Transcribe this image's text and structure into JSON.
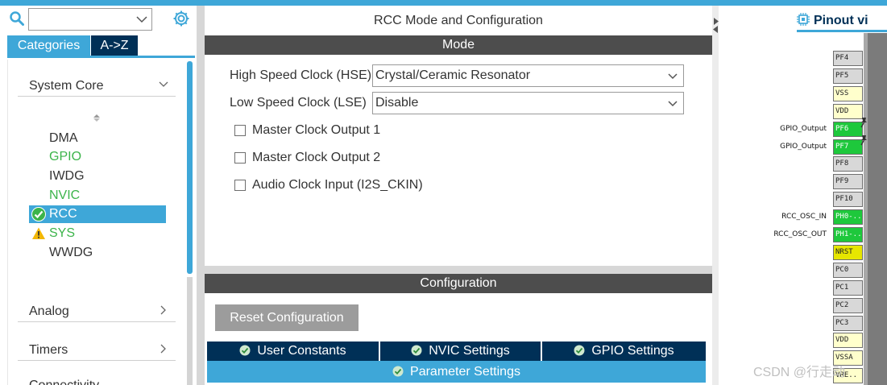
{
  "colors": {
    "accent": "#3ea7d8",
    "navy": "#003057",
    "bar": "#4d4d4d",
    "pin_green": "#1ec83c",
    "pin_yellow": "#e6e600",
    "pin_cream": "#ffffcc",
    "pin_gray": "#d8d8d8"
  },
  "left": {
    "search": {
      "value": "",
      "placeholder": ""
    },
    "tabs": [
      {
        "label": "Categories"
      },
      {
        "label": "A->Z"
      }
    ],
    "sections": [
      {
        "label": "System Core",
        "expanded": true
      },
      {
        "label": "Analog",
        "expanded": false
      },
      {
        "label": "Timers",
        "expanded": false
      },
      {
        "label": "Connectivity",
        "expanded": false
      }
    ],
    "items": [
      {
        "label": "DMA",
        "color": "#333333",
        "status": "none"
      },
      {
        "label": "GPIO",
        "color": "#3cb44a",
        "status": "none"
      },
      {
        "label": "IWDG",
        "color": "#333333",
        "status": "none"
      },
      {
        "label": "NVIC",
        "color": "#3cb44a",
        "status": "none"
      },
      {
        "label": "RCC",
        "color": "#ffffff",
        "status": "ok",
        "selected": true
      },
      {
        "label": "SYS",
        "color": "#3cb44a",
        "status": "warning"
      },
      {
        "label": "WWDG",
        "color": "#333333",
        "status": "none"
      }
    ]
  },
  "main": {
    "title": "RCC Mode and Configuration",
    "mode_header": "Mode",
    "hse": {
      "label": "High Speed Clock (HSE)",
      "value": "Crystal/Ceramic Resonator"
    },
    "lse": {
      "label": "Low Speed Clock (LSE)",
      "value": "Disable"
    },
    "checkboxes": [
      {
        "label": "Master Clock Output 1",
        "checked": false
      },
      {
        "label": "Master Clock Output 2",
        "checked": false
      },
      {
        "label": "Audio Clock Input (I2S_CKIN)",
        "checked": false
      }
    ],
    "config_header": "Configuration",
    "reset_label": "Reset Configuration",
    "tabs": [
      {
        "label": "User Constants"
      },
      {
        "label": "NVIC Settings"
      },
      {
        "label": "GPIO Settings"
      }
    ],
    "param_tab": {
      "label": "Parameter Settings"
    }
  },
  "pinout": {
    "title": "Pinout vi",
    "pins": [
      {
        "name": "PF4",
        "state": "gray",
        "signal": ""
      },
      {
        "name": "PF5",
        "state": "gray",
        "signal": ""
      },
      {
        "name": "VSS",
        "state": "cream",
        "signal": ""
      },
      {
        "name": "VDD",
        "state": "cream",
        "signal": ""
      },
      {
        "name": "PF6",
        "state": "green",
        "signal": "GPIO_Output"
      },
      {
        "name": "PF7",
        "state": "green",
        "signal": "GPIO_Output"
      },
      {
        "name": "PF8",
        "state": "gray",
        "signal": ""
      },
      {
        "name": "PF9",
        "state": "gray",
        "signal": ""
      },
      {
        "name": "PF10",
        "state": "gray",
        "signal": ""
      },
      {
        "name": "PH0-..",
        "state": "green",
        "signal": "RCC_OSC_IN"
      },
      {
        "name": "PH1-..",
        "state": "green",
        "signal": "RCC_OSC_OUT"
      },
      {
        "name": "NRST",
        "state": "yellow",
        "signal": ""
      },
      {
        "name": "PC0",
        "state": "gray",
        "signal": ""
      },
      {
        "name": "PC1",
        "state": "gray",
        "signal": ""
      },
      {
        "name": "PC2",
        "state": "gray",
        "signal": ""
      },
      {
        "name": "PC3",
        "state": "gray",
        "signal": ""
      },
      {
        "name": "VDD",
        "state": "cream",
        "signal": ""
      },
      {
        "name": "VSSA",
        "state": "cream",
        "signal": ""
      },
      {
        "name": "VRE..",
        "state": "cream",
        "signal": ""
      }
    ]
  },
  "watermark": "CSDN @行走动"
}
